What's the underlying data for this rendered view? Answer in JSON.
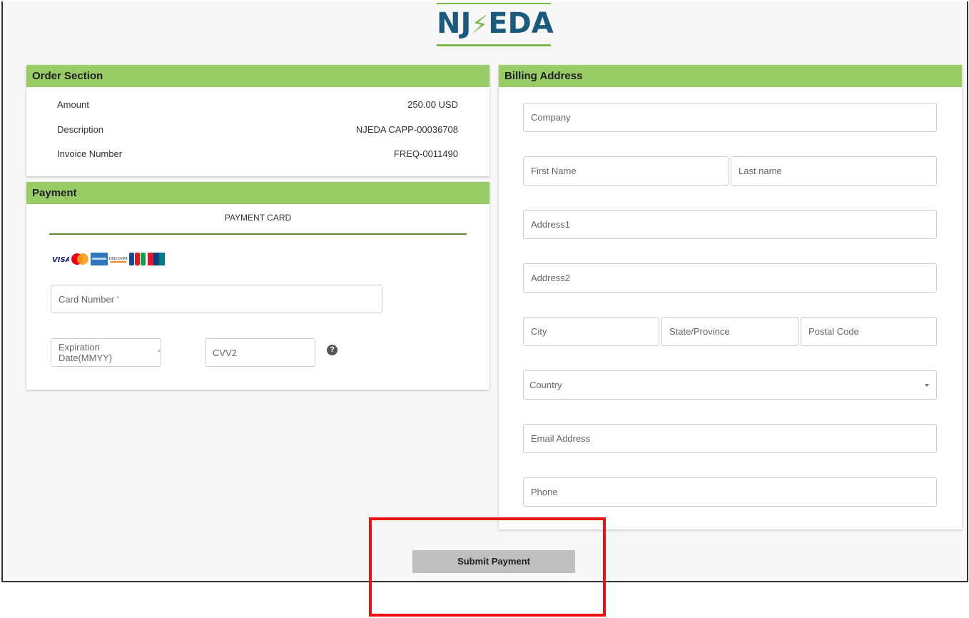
{
  "logo": {
    "text": "NJ⚡EDA",
    "text_left": "NJ",
    "text_right": "EDA"
  },
  "order": {
    "header": "Order Section",
    "rows": [
      {
        "label": "Amount",
        "value": "250.00 USD"
      },
      {
        "label": "Description",
        "value": "NJEDA CAPP-00036708"
      },
      {
        "label": "Invoice Number",
        "value": "FREQ-0011490"
      }
    ]
  },
  "payment": {
    "header": "Payment",
    "tab_label": "PAYMENT CARD",
    "card_brands": [
      "VISA",
      "MasterCard",
      "American Express",
      "DISCOVER",
      "JCB",
      "UnionPay"
    ],
    "card_number_placeholder": "Card Number",
    "expiration_placeholder": "Expiration Date(MMYY)",
    "cvv_placeholder": "CVV2",
    "required_mark": "*",
    "help_symbol": "?"
  },
  "billing": {
    "header": "Billing Address",
    "company": "Company",
    "first_name": "First Name",
    "last_name": "Last name",
    "address1": "Address1",
    "address2": "Address2",
    "city": "City",
    "state": "State/Province",
    "postal": "Postal Code",
    "country": "Country",
    "email": "Email Address",
    "phone": "Phone"
  },
  "submit_label": "Submit Payment",
  "colors": {
    "header_green": "#99cc66",
    "logo_blue": "#1c5a7d",
    "logo_green": "#7ab648",
    "highlight_red": "#ee1111",
    "button_gray": "#bfbfbf"
  }
}
